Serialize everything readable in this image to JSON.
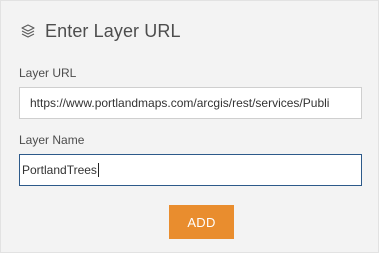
{
  "panel": {
    "title": "Enter Layer URL",
    "title_icon": "layers-icon"
  },
  "fields": {
    "url_label": "Layer URL",
    "url_value": "https://www.portlandmaps.com/arcgis/rest/services/Publi",
    "name_label": "Layer Name",
    "name_value": "PortlandTrees"
  },
  "actions": {
    "add_label": "ADD"
  },
  "colors": {
    "accent": "#e98d2e",
    "focus_border": "#2d5a8a",
    "panel_bg": "#f3f3f3"
  }
}
